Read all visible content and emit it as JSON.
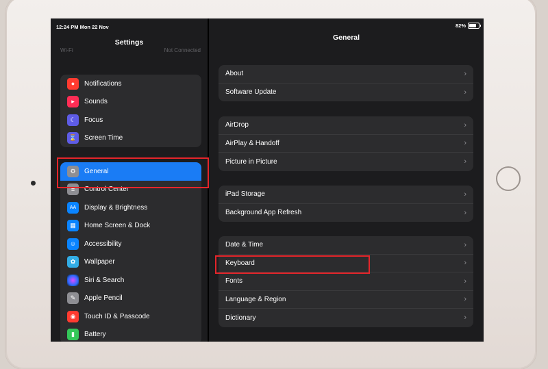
{
  "status": {
    "time": "12:24 PM  Mon 22 Nov",
    "battery": "82%"
  },
  "sidebar": {
    "title": "Settings",
    "wifi_label": "Wi-Fi",
    "wifi_value": "Not Connected",
    "group1": [
      {
        "label": "Notifications",
        "icon": "bell-icon",
        "color": "#ff3b30"
      },
      {
        "label": "Sounds",
        "icon": "speaker-icon",
        "color": "#ff2d55"
      },
      {
        "label": "Focus",
        "icon": "moon-icon",
        "color": "#5e5ce6"
      },
      {
        "label": "Screen Time",
        "icon": "hourglass-icon",
        "color": "#5e5ce6"
      }
    ],
    "group2": [
      {
        "label": "General",
        "icon": "gear-icon",
        "color": "#8e8e93",
        "selected": true
      },
      {
        "label": "Control Center",
        "icon": "toggles-icon",
        "color": "#8e8e93"
      },
      {
        "label": "Display & Brightness",
        "icon": "aa-icon",
        "color": "#0a84ff"
      },
      {
        "label": "Home Screen & Dock",
        "icon": "grid-icon",
        "color": "#0a84ff"
      },
      {
        "label": "Accessibility",
        "icon": "accessibility-icon",
        "color": "#0a84ff"
      },
      {
        "label": "Wallpaper",
        "icon": "flower-icon",
        "color": "#32ade6"
      },
      {
        "label": "Siri & Search",
        "icon": "siri-icon",
        "color": "#333336"
      },
      {
        "label": "Apple Pencil",
        "icon": "pencil-icon",
        "color": "#8e8e93"
      },
      {
        "label": "Touch ID & Passcode",
        "icon": "fingerprint-icon",
        "color": "#ff3b30"
      },
      {
        "label": "Battery",
        "icon": "battery-icon",
        "color": "#34c759"
      }
    ]
  },
  "main": {
    "title": "General",
    "group1": [
      {
        "label": "About"
      },
      {
        "label": "Software Update"
      }
    ],
    "group2": [
      {
        "label": "AirDrop"
      },
      {
        "label": "AirPlay & Handoff"
      },
      {
        "label": "Picture in Picture"
      }
    ],
    "group3": [
      {
        "label": "iPad Storage"
      },
      {
        "label": "Background App Refresh"
      }
    ],
    "group4": [
      {
        "label": "Date & Time"
      },
      {
        "label": "Keyboard"
      },
      {
        "label": "Fonts"
      },
      {
        "label": "Language & Region"
      },
      {
        "label": "Dictionary"
      }
    ],
    "chevron": "›"
  },
  "colors": {
    "highlight": "#e5252a",
    "selected": "#1a7cf5"
  }
}
